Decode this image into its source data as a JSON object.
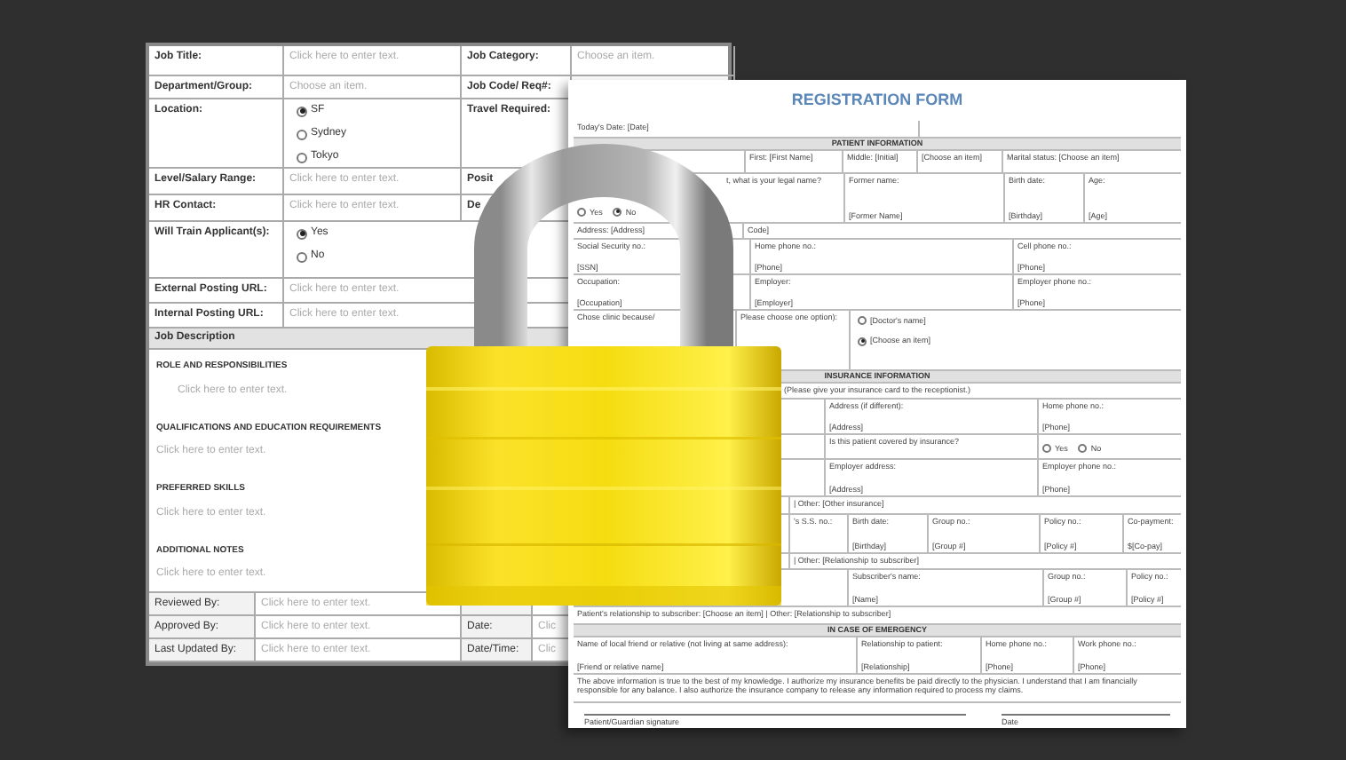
{
  "job_form": {
    "rows": [
      {
        "kind": "field",
        "label": "Job Title:",
        "value": "Click here to enter text.",
        "label_2": "Job Category:",
        "value_2": "Choose an item."
      },
      {
        "kind": "field",
        "label": "Department/Group:",
        "value": "Choose an item.",
        "label_2": "Job Code/ Req#:"
      },
      {
        "kind": "radios",
        "label": "Location:",
        "options": [
          {
            "label": "SF",
            "selected": true
          },
          {
            "label": "Sydney",
            "selected": false
          },
          {
            "label": "Tokyo",
            "selected": false
          }
        ],
        "label_2": "Travel Required:"
      },
      {
        "kind": "field",
        "label": "Level/Salary Range:",
        "value": "Click here to enter text.",
        "label_2": "Posit"
      },
      {
        "kind": "field",
        "label": "HR Contact:",
        "value": "Click here to enter text.",
        "label_2": "De"
      },
      {
        "kind": "radios",
        "label": "Will Train Applicant(s):",
        "options": [
          {
            "label": "Yes",
            "selected": true
          },
          {
            "label": "No",
            "selected": false
          }
        ]
      },
      {
        "kind": "field",
        "label": "External Posting URL:",
        "value": "Click here to enter text."
      },
      {
        "kind": "field",
        "label": "Internal Posting URL:",
        "value": "Click here to enter text."
      },
      {
        "kind": "header",
        "label": "Job Description"
      }
    ],
    "sections": [
      {
        "heading": "ROLE AND RESPONSIBILITIES",
        "text": "Click here to enter text.",
        "indented": true
      },
      {
        "heading": "QUALIFICATIONS AND EDUCATION REQUIREMENTS",
        "text": "Click here to enter text.",
        "indented": false
      },
      {
        "heading": "PREFERRED SKILLS",
        "text": "Click here to enter text.",
        "indented": false
      },
      {
        "heading": "ADDITIONAL NOTES",
        "text": "Click here to enter text.",
        "indented": false
      }
    ],
    "footer": [
      {
        "label": "Reviewed By:",
        "value": "Click here to enter text."
      },
      {
        "label": "Approved By:",
        "value": "Click here to enter text.",
        "label_2": "Date:",
        "value_2": "Clic"
      },
      {
        "label": "Last Updated By:",
        "value": "Click here to enter text.",
        "label_2": "Date/Time:",
        "value_2": "Clic"
      }
    ]
  },
  "registration_form": {
    "title": "REGISTRATION FORM",
    "rows": [
      {
        "kind": "cells",
        "cells": [
          {
            "label": "Today's Date: [Date]"
          }
        ]
      },
      {
        "kind": "header",
        "label": "PATIENT INFORMATION"
      },
      {
        "kind": "cells",
        "cells": [
          {
            "label": "First: [First Name]"
          },
          {
            "label": "Middle: [Initial]"
          },
          {
            "label": "[Choose an item]"
          },
          {
            "label": "Marital status: [Choose an item]"
          }
        ]
      },
      {
        "kind": "cells",
        "cells": [
          {
            "options": [
              {
                "label": "Yes",
                "selected": false
              },
              {
                "label": "No",
                "selected": true
              }
            ]
          },
          {
            "label": "t, what is your legal name?"
          },
          {
            "label": "Former name:",
            "value": "[Former Name]"
          },
          {
            "label": "Birth date:",
            "value": "[Birthday]"
          },
          {
            "label": "Age:",
            "value": "[Age]"
          }
        ]
      },
      {
        "kind": "cells",
        "cells": [
          {
            "label": "Address: [Address]"
          },
          {
            "label": "Code]"
          }
        ]
      },
      {
        "kind": "cells",
        "cells": [
          {
            "label": "Social Security no.:",
            "value": "[SSN]"
          },
          {
            "label": "Home phone no.:",
            "value": "[Phone]"
          },
          {
            "label": "Cell phone no.:",
            "value": "[Phone]"
          }
        ]
      },
      {
        "kind": "cells",
        "cells": [
          {
            "label": "Occupation:",
            "value": "[Occupation]"
          },
          {
            "label": "Employer:",
            "value": "[Employer]"
          },
          {
            "label": "Employer phone no.:",
            "value": "[Phone]"
          }
        ]
      },
      {
        "kind": "cells",
        "cells": [
          {
            "label": "Chose clinic because/"
          },
          {
            "label": "Please choose one option):"
          },
          {
            "options": [
              {
                "label": "[Doctor's name]",
                "selected": false
              },
              {
                "label": "[Choose an item]",
                "selected": true
              }
            ]
          }
        ]
      },
      {
        "kind": "header",
        "label": "INSURANCE INFORMATION"
      },
      {
        "kind": "note",
        "label": "(Please give your insurance card to the receptionist.)"
      },
      {
        "kind": "cells",
        "cells": [
          {
            "label": "Address (if different):",
            "value": "[Address]"
          },
          {
            "label": "Home phone no.:",
            "value": "[Phone]"
          }
        ]
      },
      {
        "kind": "cells",
        "cells": [
          {
            "label": "Is this patient covered by insurance?"
          },
          {
            "options": [
              {
                "label": "Yes",
                "selected": false
              },
              {
                "label": "No",
                "selected": false
              }
            ]
          }
        ]
      },
      {
        "kind": "cells",
        "cells": [
          {
            "label": "Employer address:",
            "value": "[Address]"
          },
          {
            "label": "Employer phone no.:",
            "value": "[Phone]"
          }
        ]
      },
      {
        "kind": "cells",
        "cells": [
          {
            "label": "| Other: [Other insurance]"
          }
        ]
      },
      {
        "kind": "cells",
        "cells": [
          {
            "label": "'s S.S. no.:"
          },
          {
            "label": "Birth date:",
            "value": "[Birthday]"
          },
          {
            "label": "Group no.:",
            "value": "[Group #]"
          },
          {
            "label": "Policy no.:",
            "value": "[Policy #]"
          },
          {
            "label": "Co-payment:",
            "value": "$[Co-pay]"
          }
        ]
      },
      {
        "kind": "cells",
        "cells": [
          {
            "label": "| Other: [Relationship to subscriber]"
          }
        ]
      },
      {
        "kind": "cells",
        "cells": [
          {
            "label": "Subscriber's name:",
            "value": "[Name]"
          },
          {
            "label": "Group no.:",
            "value": "[Group #]"
          },
          {
            "label": "Policy no.:",
            "value": "[Policy #]"
          }
        ]
      },
      {
        "kind": "cells",
        "cells": [
          {
            "label": "Patient's relationship to subscriber: [Choose an item] | Other: [Relationship to subscriber]"
          }
        ]
      },
      {
        "kind": "header",
        "label": "IN CASE OF EMERGENCY"
      },
      {
        "kind": "cells",
        "cells": [
          {
            "label": "Name of local friend or relative (not living at same address):",
            "value": "[Friend or relative name]"
          },
          {
            "label": "Relationship to patient:",
            "value": "[Relationship]"
          },
          {
            "label": "Home phone no.:",
            "value": "[Phone]"
          },
          {
            "label": "Work phone no.:",
            "value": "[Phone]"
          }
        ]
      },
      {
        "kind": "paragraph",
        "label": "The above information is true to the best of my knowledge. I authorize my insurance benefits be paid directly to the physician. I understand that I am financially responsible for any balance. I also authorize the insurance company to release any information required to process my claims."
      },
      {
        "kind": "signature",
        "labels": [
          "Patient/Guardian signature",
          "Date"
        ]
      }
    ]
  }
}
